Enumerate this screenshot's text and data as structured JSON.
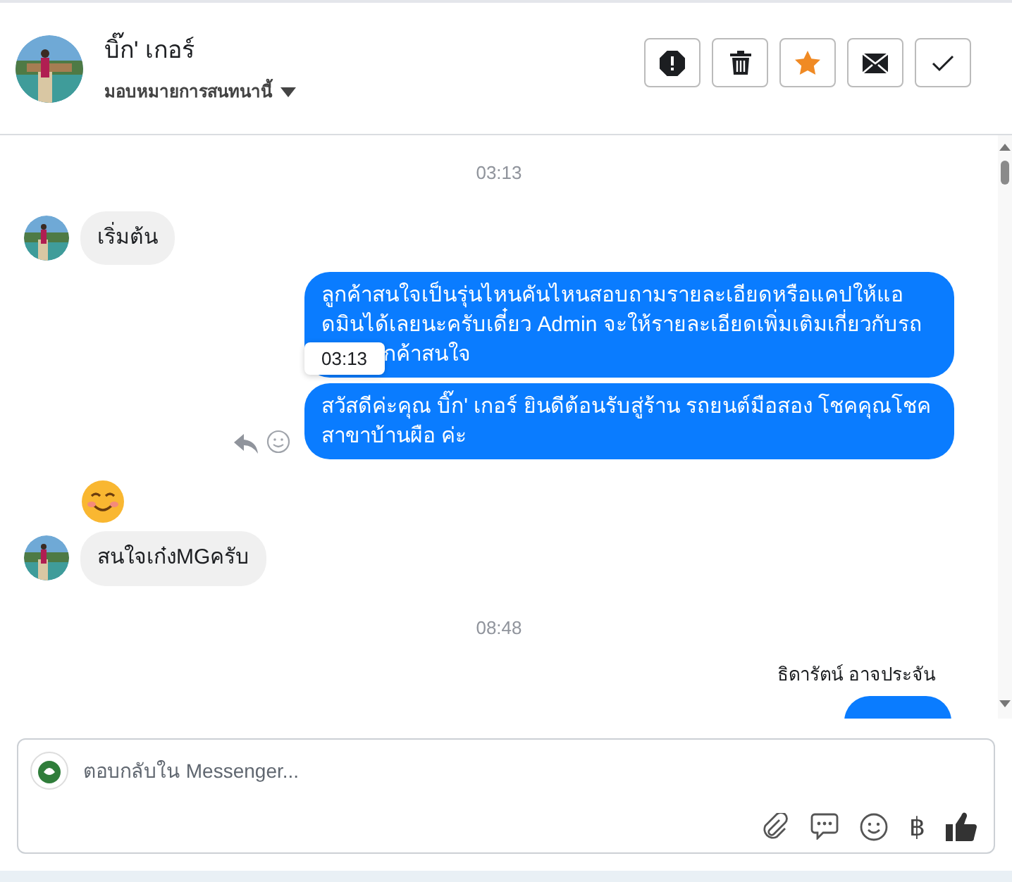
{
  "header": {
    "name": "บิ๊ก' เกอร์",
    "assign_label": "มอบหมายการสนทนานี้"
  },
  "messages": [
    {
      "kind": "time",
      "text": "03:13"
    },
    {
      "kind": "incoming",
      "text": "เริ่มต้น"
    },
    {
      "kind": "outgoing",
      "lines": [
        "ลูกค้าสนใจเป็นรุ่นไหนคันไหนสอบถามรายละเอียดหรือแคปให้แอ",
        "ดมินได้เลยนะครับเดี๋ยว Admin จะให้รายละเอียดเพิ่มเติมเกี่ยวกับรถ",
        "กค้าสนใจ"
      ],
      "tooltip": "03:13"
    },
    {
      "kind": "outgoing",
      "lines": [
        "สวัสดีค่ะคุณ บิ๊ก' เกอร์ ยินดีต้อนรับสู่ร้าน รถยนต์มือสอง โชคคุณโชค",
        "สาขาบ้านผือ ค่ะ"
      ],
      "actions": true
    },
    {
      "kind": "emoji"
    },
    {
      "kind": "incoming",
      "text": "สนใจเก๋งMGครับ"
    },
    {
      "kind": "time",
      "text": "08:48"
    },
    {
      "kind": "sender",
      "text": "ธิดารัตน์ อาจประจัน"
    },
    {
      "kind": "partial"
    }
  ],
  "composer": {
    "placeholder": "ตอบกลับใน Messenger...",
    "currency_symbol": "฿"
  }
}
